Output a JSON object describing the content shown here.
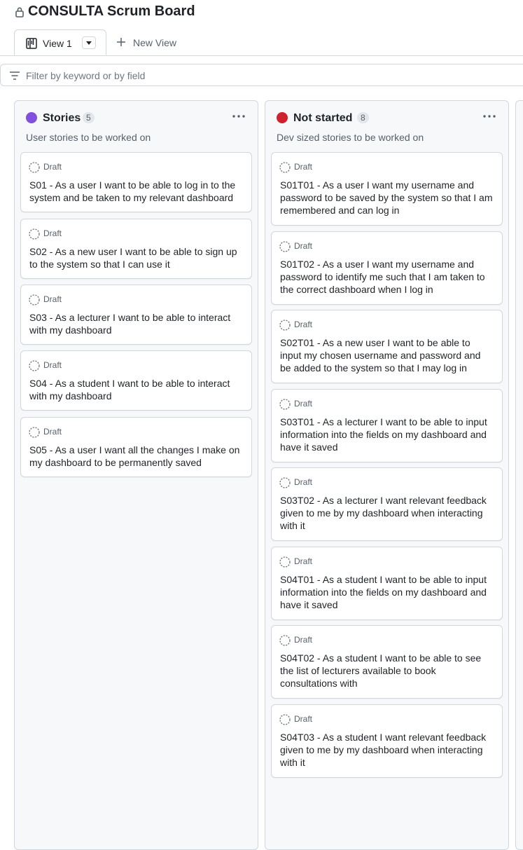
{
  "header": {
    "title": "CONSULTA Scrum Board"
  },
  "tabs": {
    "view_label": "View 1",
    "new_view_label": "New View"
  },
  "filter": {
    "placeholder": "Filter by keyword or by field"
  },
  "columns": [
    {
      "name": "Stories",
      "count": "5",
      "description": "User stories to be worked on",
      "color": "#8250df",
      "cards": [
        {
          "status": "Draft",
          "text": "S01 - As a user I want to be able to log in to the system and be taken to my relevant dashboard"
        },
        {
          "status": "Draft",
          "text": "S02 - As a new user I want to be able to sign up to the system so that I can use it"
        },
        {
          "status": "Draft",
          "text": "S03 - As a lecturer I want to be able to interact with my dashboard"
        },
        {
          "status": "Draft",
          "text": "S04 - As a student I want to be able to interact with my dashboard"
        },
        {
          "status": "Draft",
          "text": "S05 - As a user I want all the changes I make on my dashboard to be permanently saved"
        }
      ]
    },
    {
      "name": "Not started",
      "count": "8",
      "description": "Dev sized stories to be worked on",
      "color": "#cf222e",
      "cards": [
        {
          "status": "Draft",
          "text": "S01T01 - As a user I want my username and password to be saved by the system so that I am remembered and can log in"
        },
        {
          "status": "Draft",
          "text": "S01T02 - As a user I want my username and password to identify me such that I am taken to the correct dashboard when I log in"
        },
        {
          "status": "Draft",
          "text": "S02T01 - As a new user I want to be able to input my chosen username and password and be added to the system so that I may log in"
        },
        {
          "status": "Draft",
          "text": "S03T01 - As a lecturer I want to be able to input information into the fields on my dashboard and have it saved"
        },
        {
          "status": "Draft",
          "text": "S03T02 - As a lecturer I want relevant feedback given to me by my dashboard when interacting with it"
        },
        {
          "status": "Draft",
          "text": "S04T01 - As a student I want to be able to input information into the fields on my dashboard and have it saved"
        },
        {
          "status": "Draft",
          "text": "S04T02 - As a student I want to be able to see the list of lecturers available to book consultations with"
        },
        {
          "status": "Draft",
          "text": "S04T03 - As a student I want relevant feedback given to me by my dashboard when interacting with it"
        }
      ]
    }
  ]
}
